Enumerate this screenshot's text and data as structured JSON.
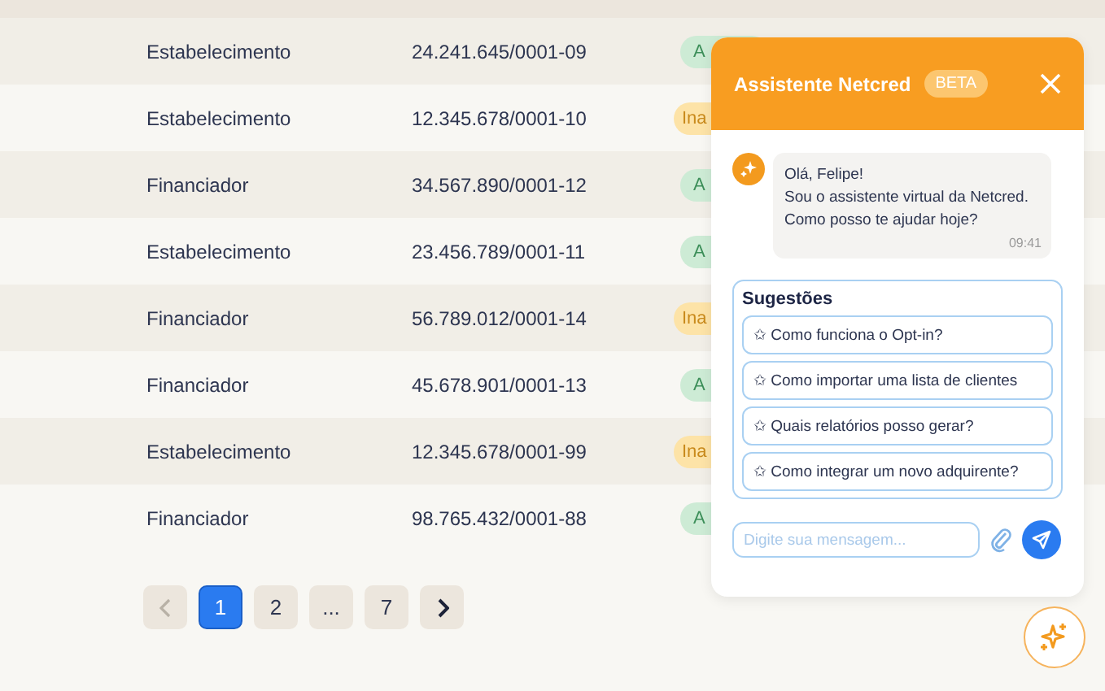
{
  "table": {
    "rows": [
      {
        "type": "Estabelecimento",
        "cnpj": "24.241.645/0001-09",
        "status": {
          "kind": "active",
          "label": "A"
        }
      },
      {
        "type": "Estabelecimento",
        "cnpj": "12.345.678/0001-10",
        "status": {
          "kind": "inactive",
          "label": "Ina"
        }
      },
      {
        "type": "Financiador",
        "cnpj": "34.567.890/0001-12",
        "status": {
          "kind": "active",
          "label": "A"
        }
      },
      {
        "type": "Estabelecimento",
        "cnpj": "23.456.789/0001-11",
        "status": {
          "kind": "active",
          "label": "A"
        }
      },
      {
        "type": "Financiador",
        "cnpj": "56.789.012/0001-14",
        "status": {
          "kind": "inactive",
          "label": "Ina"
        }
      },
      {
        "type": "Financiador",
        "cnpj": "45.678.901/0001-13",
        "status": {
          "kind": "active",
          "label": "A"
        }
      },
      {
        "type": "Estabelecimento",
        "cnpj": "12.345.678/0001-99",
        "status": {
          "kind": "inactive",
          "label": "Ina"
        }
      },
      {
        "type": "Financiador",
        "cnpj": "98.765.432/0001-88",
        "status": {
          "kind": "active",
          "label": "A"
        }
      }
    ]
  },
  "pagination": {
    "prev_disabled": true,
    "pages": [
      {
        "label": "1",
        "selected": true
      },
      {
        "label": "2",
        "selected": false
      },
      {
        "label": "...",
        "selected": false
      },
      {
        "label": "7",
        "selected": false
      }
    ]
  },
  "chat": {
    "title": "Assistente Netcred",
    "badge": "BETA",
    "message": {
      "lines": [
        "Olá, Felipe!",
        "Sou o assistente virtual da Netcred.",
        "Como posso te ajudar hoje?"
      ],
      "time": "09:41"
    },
    "suggestions_title": "Sugestões",
    "suggestions": [
      "✩ Como funciona o Opt-in?",
      "✩ Como importar uma lista de clientes",
      "✩ Quais relatórios posso gerar?",
      "✩ Como integrar um novo adquirente?"
    ],
    "input": {
      "placeholder": "Digite sua mensagem..."
    }
  }
}
